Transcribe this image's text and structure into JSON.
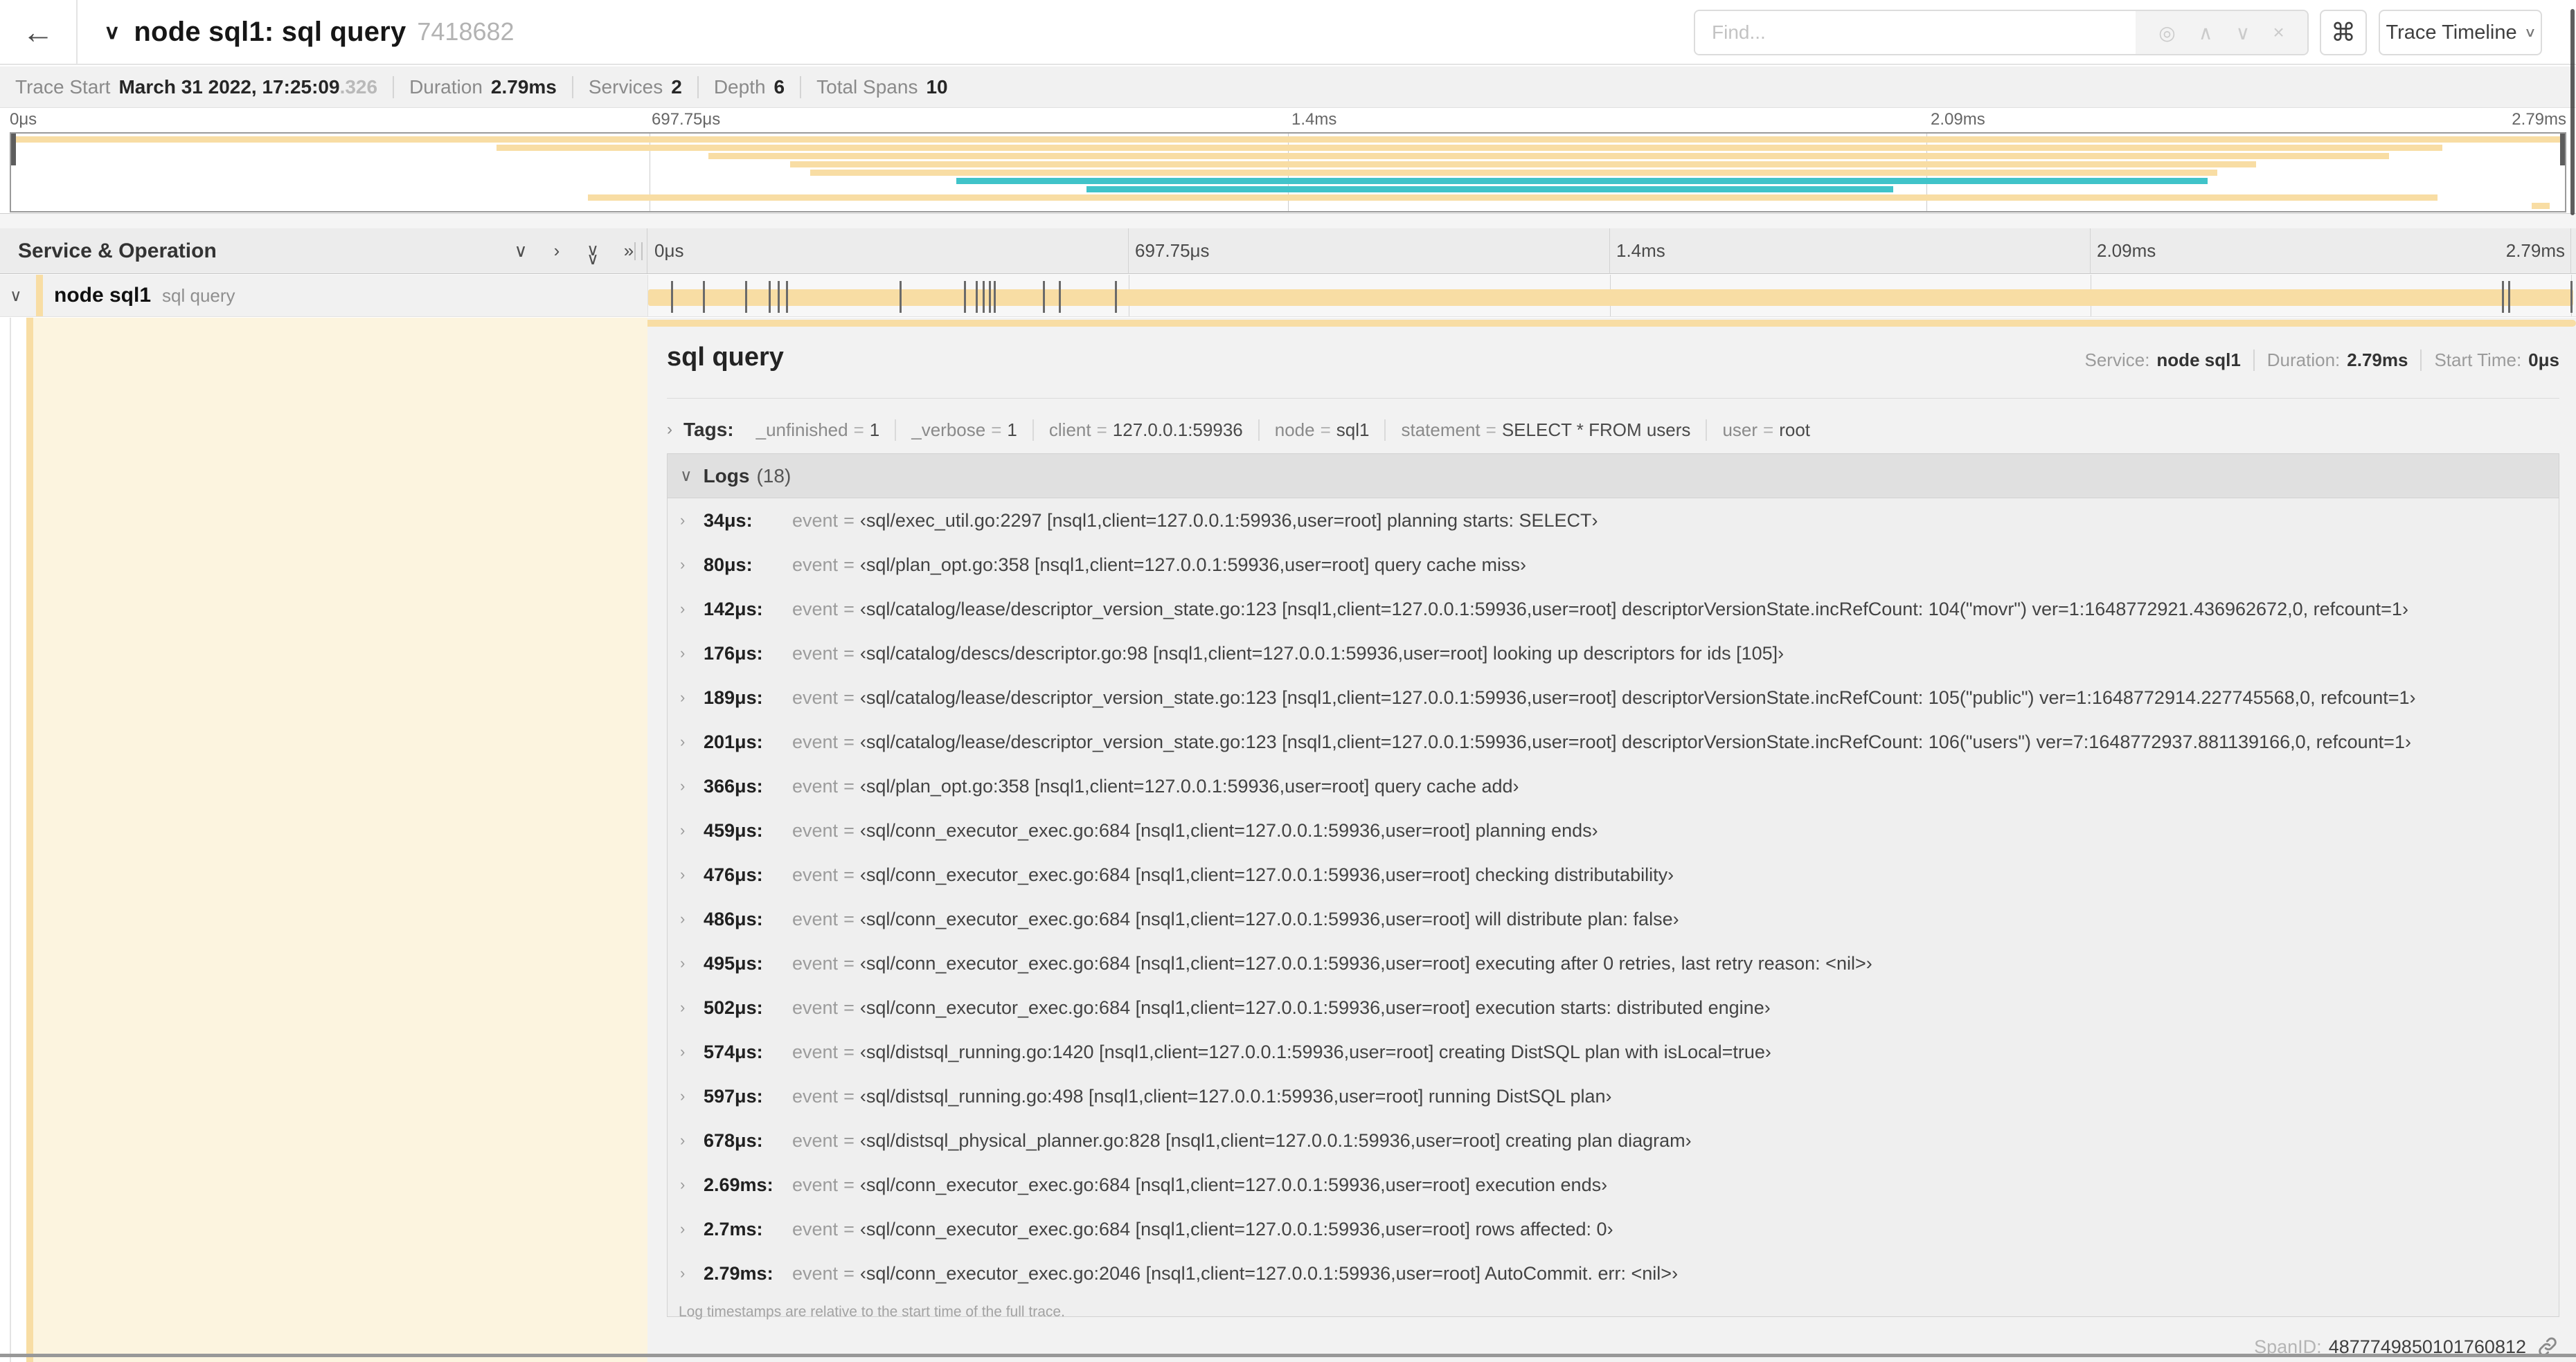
{
  "palette": {
    "tan": "#F8DDA4",
    "teal": "#40C3C9"
  },
  "header": {
    "back": "←",
    "collapse": "∨",
    "title": "node sql1: sql query",
    "trace_id": "7418682",
    "find_placeholder": "Find...",
    "suffix_icons": {
      "locate": "◎",
      "prev": "∧",
      "next": "∨",
      "clear": "×"
    },
    "shortcut": "⌘",
    "view_button": "Trace Timeline",
    "view_chevron": "∨"
  },
  "trace_info": {
    "start_label": "Trace Start",
    "start_value": "March 31 2022, 17:25:09",
    "start_fraction": ".326",
    "duration_label": "Duration",
    "duration_value": "2.79ms",
    "services_label": "Services",
    "services_value": "2",
    "depth_label": "Depth",
    "depth_value": "6",
    "spans_label": "Total Spans",
    "spans_value": "10"
  },
  "minimap": {
    "labels": [
      "0μs",
      "697.75μs",
      "1.4ms",
      "2.09ms",
      "2.79ms"
    ],
    "bars": [
      {
        "row": 0,
        "start": 0,
        "end": 100,
        "color": "tan"
      },
      {
        "row": 1,
        "start": 19.0,
        "end": 95.2,
        "color": "tan"
      },
      {
        "row": 2,
        "start": 27.3,
        "end": 93.1,
        "color": "tan"
      },
      {
        "row": 3,
        "start": 30.5,
        "end": 87.9,
        "color": "tan"
      },
      {
        "row": 4,
        "start": 31.3,
        "end": 86.4,
        "color": "tan"
      },
      {
        "row": 5,
        "start": 37.0,
        "end": 86.0,
        "color": "teal"
      },
      {
        "row": 6,
        "start": 42.1,
        "end": 73.7,
        "color": "teal"
      },
      {
        "row": 7,
        "start": 22.6,
        "end": 95.0,
        "color": "tan"
      },
      {
        "row": 8,
        "start": 98.7,
        "end": 99.4,
        "color": "tan"
      }
    ]
  },
  "timeline_header": {
    "title": "Service & Operation",
    "icons": {
      "collapse_one": "∨",
      "expand_one": "›",
      "collapse_all": "∨∨",
      "expand_all": "»"
    },
    "labels": [
      "0μs",
      "697.75μs",
      "1.4ms",
      "2.09ms",
      "2.79ms"
    ]
  },
  "span_row": {
    "chevron": "∨",
    "service": "node sql1",
    "operation": "sql query",
    "tick_percents": [
      1.22,
      2.87,
      5.09,
      6.31,
      6.77,
      7.2,
      13.12,
      16.45,
      17.06,
      17.42,
      17.74,
      18.0,
      20.57,
      21.4,
      24.3,
      96.42,
      96.77,
      100
    ]
  },
  "detail": {
    "title": "sql query",
    "meta": [
      {
        "label": "Service:",
        "value": "node sql1"
      },
      {
        "label": "Duration:",
        "value": "2.79ms"
      },
      {
        "label": "Start Time:",
        "value": "0μs"
      }
    ],
    "tags_chevron": "›",
    "tags_label": "Tags:",
    "tags": [
      {
        "key": "_unfinished",
        "value": "1"
      },
      {
        "key": "_verbose",
        "value": "1"
      },
      {
        "key": "client",
        "value": "127.0.0.1:59936"
      },
      {
        "key": "node",
        "value": "sql1"
      },
      {
        "key": "statement",
        "value": "SELECT * FROM users"
      },
      {
        "key": "user",
        "value": "root"
      }
    ],
    "logs_chevron": "∨",
    "logs_label": "Logs",
    "logs_count": "(18)",
    "log_field": "event",
    "logs": [
      {
        "time": "34μs:",
        "key": "event",
        "value": "‹sql/exec_util.go:2297 [nsql1,client=127.0.0.1:59936,user=root] planning starts: SELECT›"
      },
      {
        "time": "80μs:",
        "key": "event",
        "value": "‹sql/plan_opt.go:358 [nsql1,client=127.0.0.1:59936,user=root] query cache miss›"
      },
      {
        "time": "142μs:",
        "key": "event",
        "value": "‹sql/catalog/lease/descriptor_version_state.go:123 [nsql1,client=127.0.0.1:59936,user=root] descriptorVersionState.incRefCount: 104(\"movr\") ver=1:1648772921.436962672,0, refcount=1›"
      },
      {
        "time": "176μs:",
        "key": "event",
        "value": "‹sql/catalog/descs/descriptor.go:98 [nsql1,client=127.0.0.1:59936,user=root] looking up descriptors for ids [105]›"
      },
      {
        "time": "189μs:",
        "key": "event",
        "value": "‹sql/catalog/lease/descriptor_version_state.go:123 [nsql1,client=127.0.0.1:59936,user=root] descriptorVersionState.incRefCount: 105(\"public\") ver=1:1648772914.227745568,0, refcount=1›"
      },
      {
        "time": "201μs:",
        "key": "event",
        "value": "‹sql/catalog/lease/descriptor_version_state.go:123 [nsql1,client=127.0.0.1:59936,user=root] descriptorVersionState.incRefCount: 106(\"users\") ver=7:1648772937.881139166,0, refcount=1›"
      },
      {
        "time": "366μs:",
        "key": "event",
        "value": "‹sql/plan_opt.go:358 [nsql1,client=127.0.0.1:59936,user=root] query cache add›"
      },
      {
        "time": "459μs:",
        "key": "event",
        "value": "‹sql/conn_executor_exec.go:684 [nsql1,client=127.0.0.1:59936,user=root] planning ends›"
      },
      {
        "time": "476μs:",
        "key": "event",
        "value": "‹sql/conn_executor_exec.go:684 [nsql1,client=127.0.0.1:59936,user=root] checking distributability›"
      },
      {
        "time": "486μs:",
        "key": "event",
        "value": "‹sql/conn_executor_exec.go:684 [nsql1,client=127.0.0.1:59936,user=root] will distribute plan: false›"
      },
      {
        "time": "495μs:",
        "key": "event",
        "value": "‹sql/conn_executor_exec.go:684 [nsql1,client=127.0.0.1:59936,user=root] executing after 0 retries, last retry reason: <nil>›"
      },
      {
        "time": "502μs:",
        "key": "event",
        "value": "‹sql/conn_executor_exec.go:684 [nsql1,client=127.0.0.1:59936,user=root] execution starts: distributed engine›"
      },
      {
        "time": "574μs:",
        "key": "event",
        "value": "‹sql/distsql_running.go:1420 [nsql1,client=127.0.0.1:59936,user=root] creating DistSQL plan with isLocal=true›"
      },
      {
        "time": "597μs:",
        "key": "event",
        "value": "‹sql/distsql_running.go:498 [nsql1,client=127.0.0.1:59936,user=root] running DistSQL plan›"
      },
      {
        "time": "678μs:",
        "key": "event",
        "value": "‹sql/distsql_physical_planner.go:828 [nsql1,client=127.0.0.1:59936,user=root] creating plan diagram›"
      },
      {
        "time": "2.69ms:",
        "key": "event",
        "value": "‹sql/conn_executor_exec.go:684 [nsql1,client=127.0.0.1:59936,user=root] execution ends›"
      },
      {
        "time": "2.7ms:",
        "key": "event",
        "value": "‹sql/conn_executor_exec.go:684 [nsql1,client=127.0.0.1:59936,user=root] rows affected: 0›"
      },
      {
        "time": "2.79ms:",
        "key": "event",
        "value": "‹sql/conn_executor_exec.go:2046 [nsql1,client=127.0.0.1:59936,user=root] AutoCommit. err: <nil>›"
      }
    ],
    "footer": "Log timestamps are relative to the start time of the full trace.",
    "span_id_label": "SpanID:",
    "span_id": "4877749850101760812"
  }
}
